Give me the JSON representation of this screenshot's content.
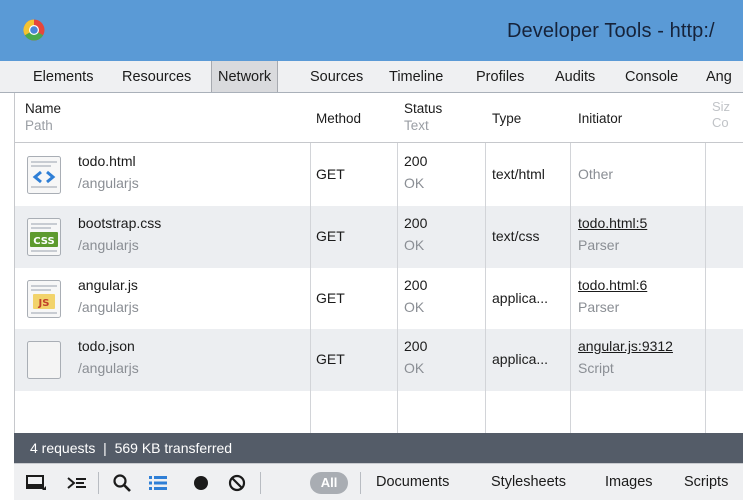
{
  "window": {
    "title": "Developer Tools - http:/"
  },
  "tabs": [
    "Elements",
    "Resources",
    "Network",
    "Sources",
    "Timeline",
    "Profiles",
    "Audits",
    "Console",
    "Ang"
  ],
  "columns": {
    "name": "Name",
    "path": "Path",
    "method": "Method",
    "status": "Status",
    "status_text": "Text",
    "type": "Type",
    "initiator": "Initiator",
    "size": "Siz",
    "size_sub": "Co"
  },
  "requests": [
    {
      "name": "todo.html",
      "path": "/angularjs",
      "method": "GET",
      "status": "200",
      "status_text": "OK",
      "type": "text/html",
      "initiator": "Other",
      "initiator_sub": "",
      "icon": "html-file-icon"
    },
    {
      "name": "bootstrap.css",
      "path": "/angularjs",
      "method": "GET",
      "status": "200",
      "status_text": "OK",
      "type": "text/css",
      "initiator": "todo.html:5",
      "initiator_sub": "Parser",
      "icon": "css-file-icon"
    },
    {
      "name": "angular.js",
      "path": "/angularjs",
      "method": "GET",
      "status": "200",
      "status_text": "OK",
      "type": "applica...",
      "initiator": "todo.html:6",
      "initiator_sub": "Parser",
      "icon": "js-file-icon"
    },
    {
      "name": "todo.json",
      "path": "/angularjs",
      "method": "GET",
      "status": "200",
      "status_text": "OK",
      "type": "applica...",
      "initiator": "angular.js:9312",
      "initiator_sub": "Script",
      "icon": "json-file-icon"
    }
  ],
  "status_bar": {
    "summary": "4 requests  |  569 KB transferred"
  },
  "bottom_bar": {
    "all_label": "All",
    "filters": [
      "Documents",
      "Stylesheets",
      "Images",
      "Scripts"
    ],
    "icons": [
      "dock-icon",
      "console-icon",
      "search-icon",
      "list-view-icon",
      "record-icon",
      "clear-icon"
    ]
  },
  "colors": {
    "title_bar": "#5a9ad6",
    "status_bar": "#545c68",
    "stripe": "#eceef1"
  }
}
